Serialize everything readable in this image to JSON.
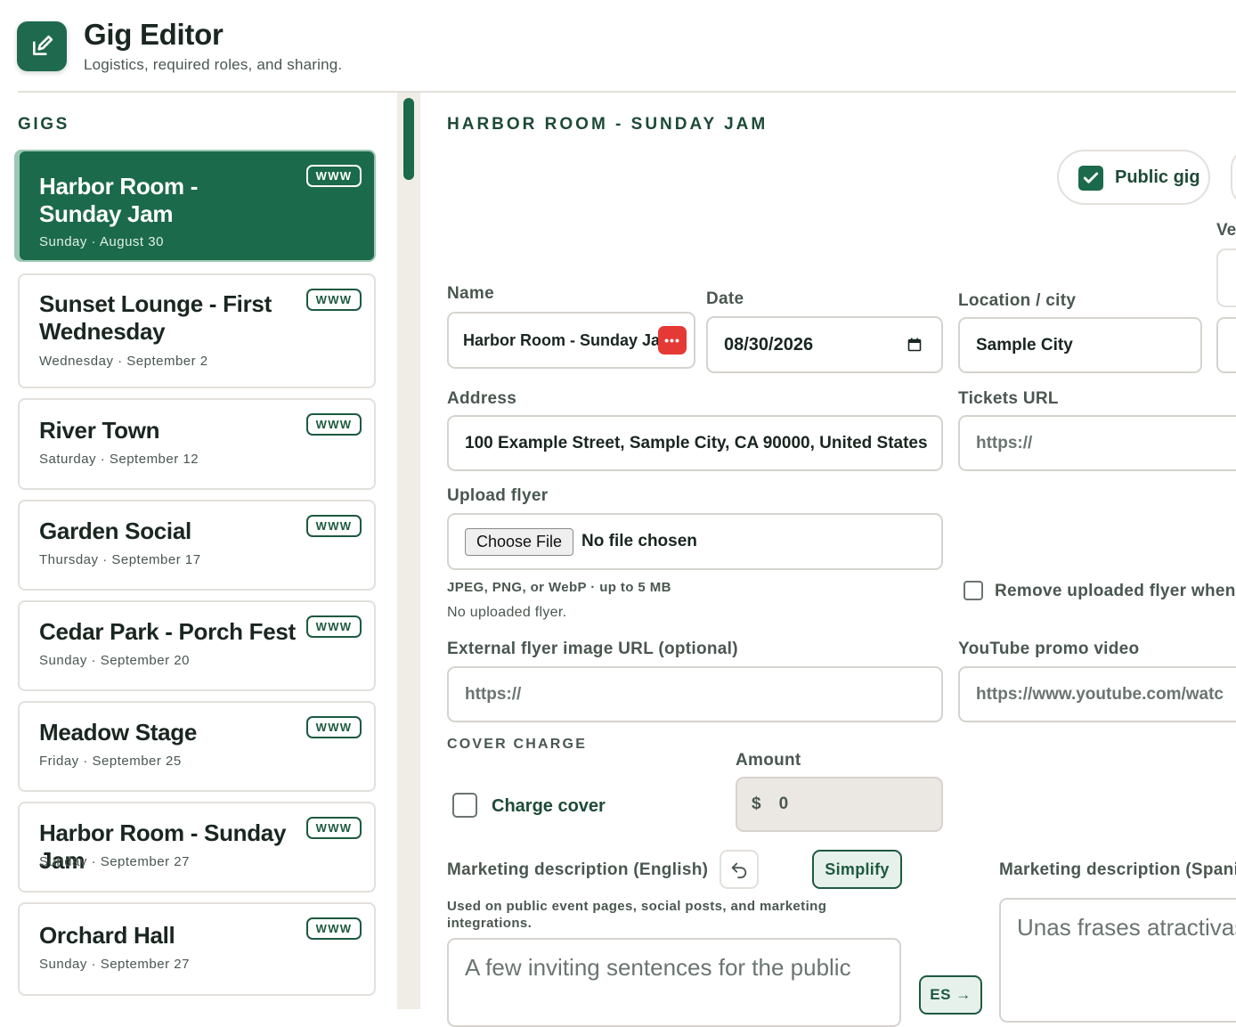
{
  "header": {
    "title": "Gig Editor",
    "subtitle": "Logistics, required roles, and sharing.",
    "icon": "edit-icon"
  },
  "sidebar": {
    "label": "GIGS",
    "www_label": "WWW",
    "gigs": [
      {
        "title": "Harbor Room - Sunday Jam",
        "date": "Sunday · August 30",
        "active": true
      },
      {
        "title": "Sunset Lounge - First Wednesday",
        "date": "Wednesday · September 2"
      },
      {
        "title": "River Town",
        "date": "Saturday · September 12"
      },
      {
        "title": "Garden Social",
        "date": "Thursday · September 17"
      },
      {
        "title": "Cedar Park - Porch Fest",
        "date": "Sunday · September 20"
      },
      {
        "title": "Meadow Stage",
        "date": "Friday · September 25"
      },
      {
        "title": "Harbor Room - Sunday Jam",
        "date": "Sunday · September 27"
      },
      {
        "title": "Orchard Hall",
        "date": "Sunday · September 27"
      }
    ]
  },
  "main": {
    "title": "HARBOR ROOM - SUNDAY JAM",
    "public_gig_label": "Public gig",
    "public_gig_checked": true,
    "ve_label": "Ve",
    "name_label": "Name",
    "name_value": "Harbor Room - Sunday Jam",
    "name_menu_glyph": "•••",
    "date_label": "Date",
    "date_value": "08/30/2026",
    "location_label": "Location / city",
    "location_value": "Sample City",
    "address_label": "Address",
    "address_value": "100 Example Street, Sample City, CA 90000, United States",
    "tickets_label": "Tickets URL",
    "tickets_placeholder": "https://",
    "upload_label": "Upload flyer",
    "choose_file": "Choose File",
    "no_file": "No file chosen",
    "upload_hint": "JPEG, PNG, or WebP · up to 5 MB",
    "no_uploaded": "No uploaded flyer.",
    "remove_flyer_label": "Remove uploaded flyer when",
    "external_label": "External flyer image URL (optional)",
    "external_placeholder": "https://",
    "youtube_label": "YouTube promo video",
    "youtube_value": "https://www.youtube.com/watc",
    "cover_label": "COVER CHARGE",
    "charge_cover_label": "Charge cover",
    "amount_label": "Amount",
    "currency": "$",
    "amount_value": "0",
    "mkt_en_label": "Marketing description (English)",
    "simplify_label": "Simplify",
    "mkt_hint": "Used on public event pages, social posts, and marketing integrations.",
    "mkt_en_placeholder": "A few inviting sentences for the public",
    "es_button": "ES →",
    "mkt_es_label": "Marketing description (Spanis",
    "mkt_es_placeholder": "Unas frases atractivas"
  },
  "colors": {
    "brand": "#1b6a4b",
    "accent_border": "#9cc7b3",
    "danger": "#e53935"
  }
}
